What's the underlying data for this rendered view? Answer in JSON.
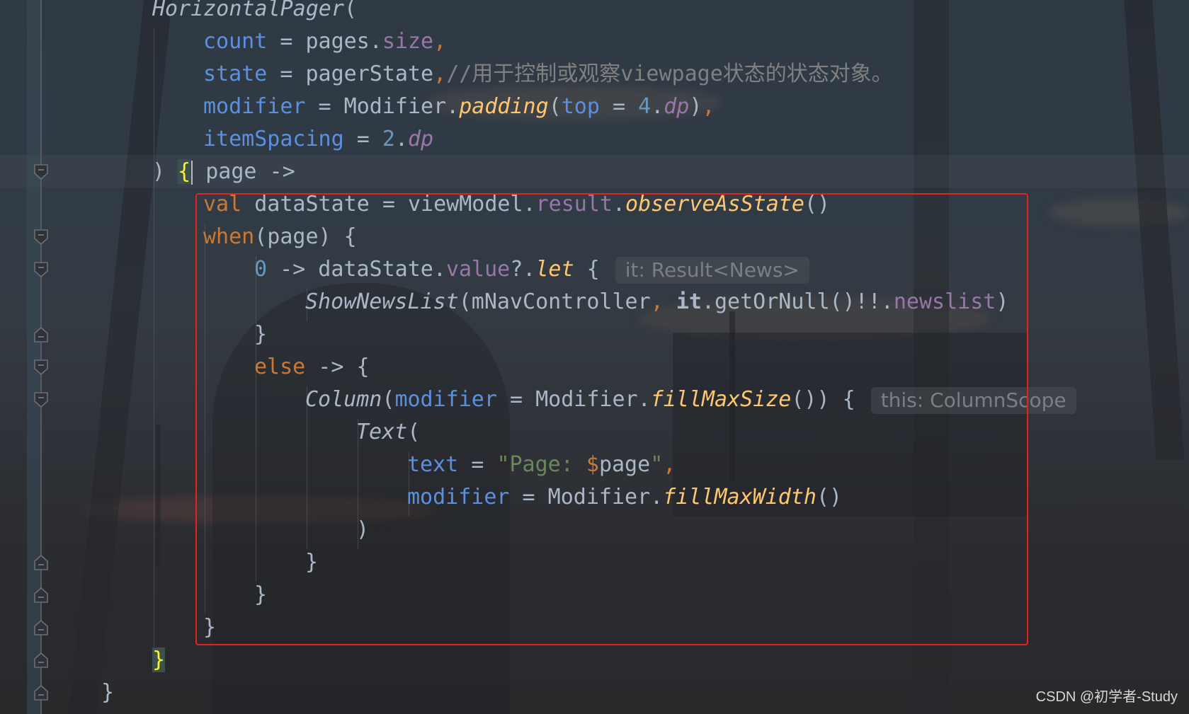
{
  "editor": {
    "lines": [
      [
        {
          "t": "HorizontalPager",
          "c": "cls-it"
        },
        {
          "t": "(",
          "c": ""
        }
      ],
      [
        {
          "t": "count",
          "c": "param"
        },
        {
          "t": " = pages.",
          "c": ""
        },
        {
          "t": "size",
          "c": "prop"
        },
        {
          "t": ",",
          "c": "punc-or"
        }
      ],
      [
        {
          "t": "state",
          "c": "param"
        },
        {
          "t": " = pagerState",
          "c": ""
        },
        {
          "t": ",",
          "c": "punc-or"
        },
        {
          "t": "//用于控制或观察viewpage状态的状态对象。",
          "c": "cmt"
        }
      ],
      [
        {
          "t": "modifier",
          "c": "param"
        },
        {
          "t": " = Modifier.",
          "c": ""
        },
        {
          "t": "padding",
          "c": "fn-it"
        },
        {
          "t": "(",
          "c": ""
        },
        {
          "t": "top",
          "c": "param"
        },
        {
          "t": " = ",
          "c": ""
        },
        {
          "t": "4",
          "c": "num"
        },
        {
          "t": ".",
          "c": ""
        },
        {
          "t": "dp",
          "c": "ext-it"
        },
        {
          "t": ")",
          "c": ""
        },
        {
          "t": ",",
          "c": "punc-or"
        }
      ],
      [
        {
          "t": "itemSpacing",
          "c": "param"
        },
        {
          "t": " = ",
          "c": ""
        },
        {
          "t": "2",
          "c": "num"
        },
        {
          "t": ".",
          "c": ""
        },
        {
          "t": "dp",
          "c": "ext-it"
        }
      ],
      [
        {
          "t": ") ",
          "c": ""
        },
        {
          "t": "{",
          "c": "brace-hl"
        },
        {
          "t": "",
          "c": "caret"
        },
        {
          "t": " page ->",
          "c": ""
        }
      ],
      [
        {
          "t": "val",
          "c": "kw"
        },
        {
          "t": " dataState = viewModel.",
          "c": ""
        },
        {
          "t": "result",
          "c": "prop"
        },
        {
          "t": ".",
          "c": ""
        },
        {
          "t": "observeAsState",
          "c": "fn-it"
        },
        {
          "t": "()",
          "c": ""
        }
      ],
      [
        {
          "t": "when",
          "c": "kw"
        },
        {
          "t": "(page) {",
          "c": ""
        }
      ],
      [
        {
          "t": "0",
          "c": "num"
        },
        {
          "t": " -> dataState.",
          "c": ""
        },
        {
          "t": "value",
          "c": "prop"
        },
        {
          "t": "?.",
          "c": ""
        },
        {
          "t": "let",
          "c": "fn-it"
        },
        {
          "t": " {",
          "c": ""
        }
      ],
      [
        {
          "t": "ShowNewsList",
          "c": "cls-it"
        },
        {
          "t": "(mNavController",
          "c": ""
        },
        {
          "t": ",",
          "c": "punc-or"
        },
        {
          "t": " ",
          "c": ""
        },
        {
          "t": "it",
          "c": "bold"
        },
        {
          "t": ".getOrNull()!!.",
          "c": ""
        },
        {
          "t": "newslist",
          "c": "prop"
        },
        {
          "t": ")",
          "c": ""
        }
      ],
      [
        {
          "t": "}",
          "c": ""
        }
      ],
      [
        {
          "t": "else",
          "c": "kw"
        },
        {
          "t": " -> {",
          "c": ""
        }
      ],
      [
        {
          "t": "Column",
          "c": "cls-it"
        },
        {
          "t": "(",
          "c": ""
        },
        {
          "t": "modifier",
          "c": "param"
        },
        {
          "t": " = Modifier.",
          "c": ""
        },
        {
          "t": "fillMaxSize",
          "c": "fn-it"
        },
        {
          "t": "()) {",
          "c": ""
        }
      ],
      [
        {
          "t": "Text",
          "c": "cls-it"
        },
        {
          "t": "(",
          "c": ""
        }
      ],
      [
        {
          "t": "text",
          "c": "param"
        },
        {
          "t": " = ",
          "c": ""
        },
        {
          "t": "\"Page: ",
          "c": "str"
        },
        {
          "t": "$",
          "c": "punc-or"
        },
        {
          "t": "page",
          "c": ""
        },
        {
          "t": "\"",
          "c": "str"
        },
        {
          "t": ",",
          "c": "punc-or"
        }
      ],
      [
        {
          "t": "modifier",
          "c": "param"
        },
        {
          "t": " = Modifier.",
          "c": ""
        },
        {
          "t": "fillMaxWidth",
          "c": "fn-it"
        },
        {
          "t": "()",
          "c": ""
        }
      ],
      [
        {
          "t": ")",
          "c": ""
        }
      ],
      [
        {
          "t": "}",
          "c": ""
        }
      ],
      [
        {
          "t": "}",
          "c": ""
        }
      ],
      [
        {
          "t": "}",
          "c": ""
        }
      ],
      [
        {
          "t": "}",
          "c": "brace-hl"
        }
      ],
      [
        {
          "t": "}",
          "c": ""
        }
      ]
    ],
    "indents": [
      1,
      2,
      2,
      2,
      2,
      1,
      2,
      2,
      3,
      4,
      3,
      3,
      4,
      5,
      6,
      6,
      5,
      4,
      3,
      2,
      1,
      0
    ],
    "inlay_hints": {
      "8": "it: Result<News>",
      "12": "this: ColumnScope"
    }
  },
  "watermark": "CSDN @初学者-Study",
  "colors": {
    "highlight_box": "#e3231d",
    "keyword": "#cc7832",
    "parameter": "#5b8fdf",
    "property": "#9876aa",
    "function": "#ffc66d",
    "number": "#6897bb",
    "string": "#6a8759",
    "comment": "#808080",
    "brace_match": "#ffef28"
  }
}
